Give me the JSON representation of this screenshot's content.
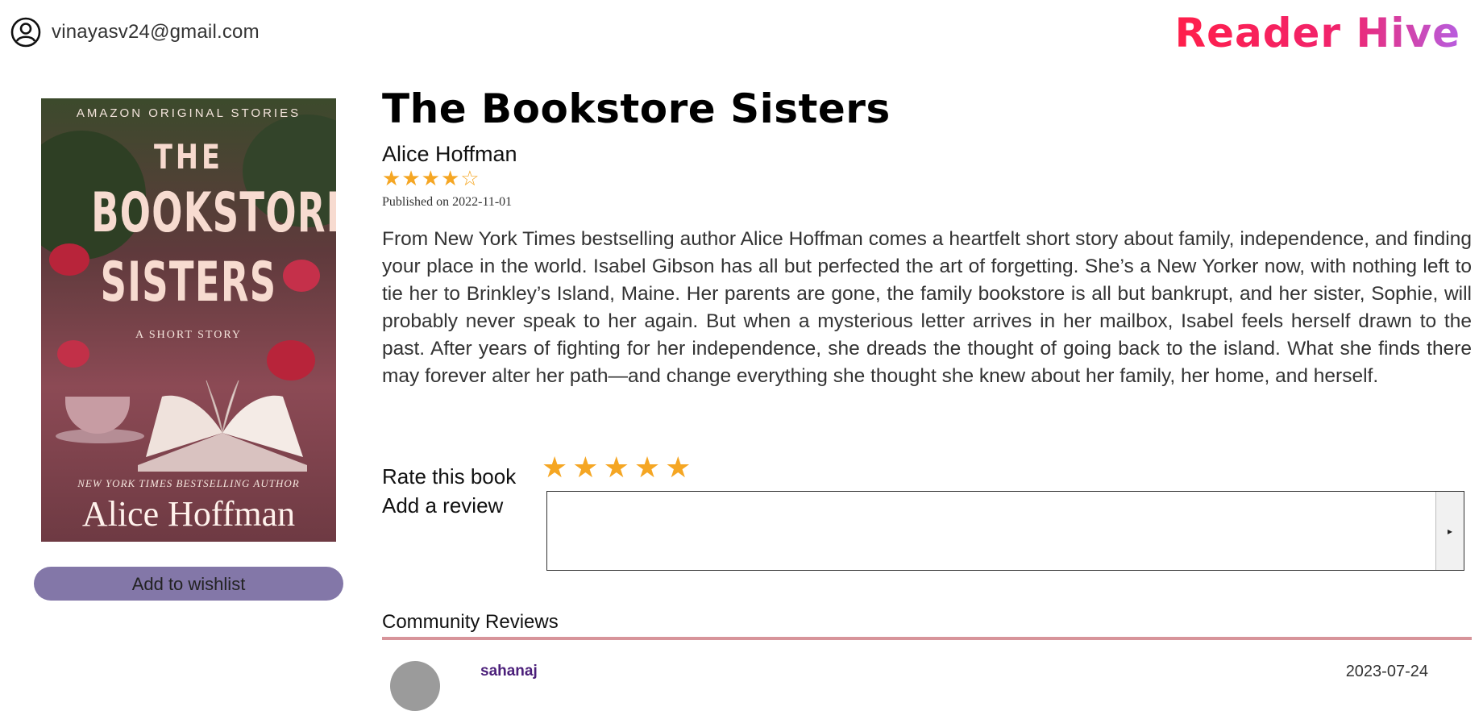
{
  "header": {
    "user_email": "vinayasv24@gmail.com",
    "user_icon": "user-circle-icon",
    "brand": "Reader Hive"
  },
  "cover": {
    "top_text": "AMAZON ORIGINAL STORIES",
    "the": "THE",
    "title_line1": "BOOKSTORE",
    "title_line2": "SISTERS",
    "subtitle": "A SHORT STORY",
    "byline": "NEW YORK TIMES BESTSELLING AUTHOR",
    "author": "Alice Hoffman"
  },
  "wishlist_label": "Add to wishlist",
  "book": {
    "title": "The Bookstore Sisters",
    "author": "Alice Hoffman",
    "rating": 4,
    "rating_max": 5,
    "published": "Published on 2022-11-01",
    "description": "From New York Times bestselling author Alice Hoffman comes a heartfelt short story about family, independence, and finding your place in the world. Isabel Gibson has all but perfected the art of forgetting. She’s a New Yorker now, with nothing left to tie her to Brinkley’s Island, Maine. Her parents are gone, the family bookstore is all but bankrupt, and her sister, Sophie, will probably never speak to her again. But when a mysterious letter arrives in her mailbox, Isabel feels herself drawn to the past. After years of fighting for her independence, she dreads the thought of going back to the island. What she finds there may forever alter her path—and change everything she thought she knew about her family, her home, and herself."
  },
  "rate": {
    "label": "Rate this book",
    "review_label": "Add a review",
    "review_value": "",
    "stars": 5,
    "submit_icon": "triangle-right-icon"
  },
  "community": {
    "heading": "Community Reviews",
    "reviews": [
      {
        "user": "sahanaj",
        "date": "2023-07-24"
      }
    ]
  },
  "colors": {
    "star": "#f5a623",
    "wishlist_bg": "#8377a8",
    "divider": "#d7949a",
    "reviewer_name": "#4b1f7a",
    "brand_start": "#ff1f4a",
    "brand_end": "#b75ee0"
  }
}
